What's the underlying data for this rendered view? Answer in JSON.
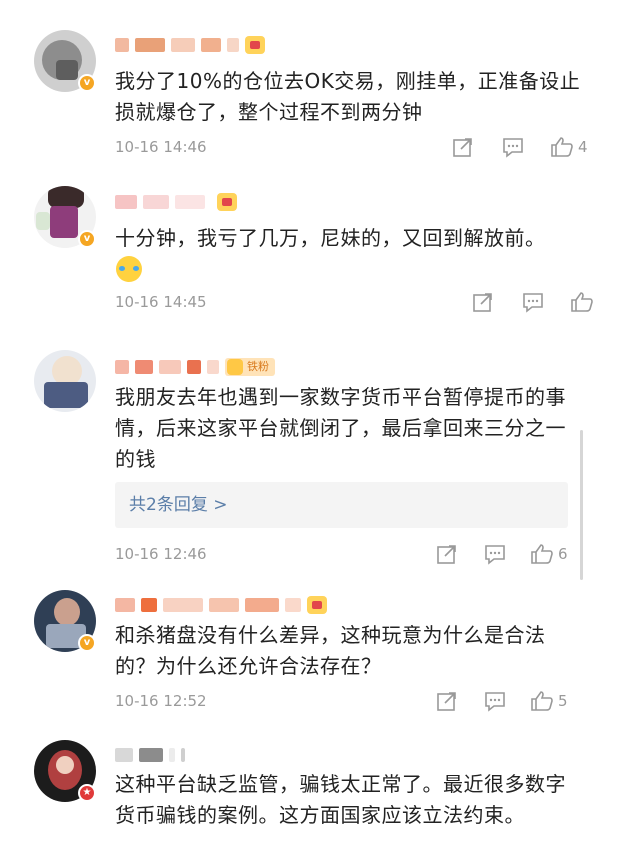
{
  "comments": [
    {
      "text": "我分了10%的仓位去OK交易，刚挂单，正准备设止损就爆仓了，整个过程不到两分钟",
      "time": "10-16 14:46",
      "likes": "4",
      "badge": "v"
    },
    {
      "text": "十分钟，我亏了几万，尼妹的，又回到解放前。",
      "time": "10-16 14:45",
      "likes": "",
      "badge": "v"
    },
    {
      "text": "我朋友去年也遇到一家数字货币平台暂停提币的事情，后来这家平台就倒闭了，最后拿回来三分之一的钱",
      "time": "10-16 12:46",
      "likes": "6",
      "replies": "共2条回复 >",
      "fan_badge": "铁粉"
    },
    {
      "text": "和杀猪盘没有什么差异，这种玩意为什么是合法的？为什么还允许合法存在？",
      "time": "10-16 12:52",
      "likes": "5",
      "badge": "v"
    },
    {
      "text": "这种平台缺乏监管，骗钱太正常了。最近很多数字货币骗钱的案例。这方面国家应该立法约束。",
      "time": "",
      "likes": "",
      "badge": "r"
    }
  ],
  "icons": {
    "share": "share-icon",
    "comment": "comment-icon",
    "like": "like-icon"
  },
  "colors": {
    "time": "#9a9a9a",
    "reply_link": "#5b7ea8",
    "verified": "#f5a623",
    "red_badge": "#e03a3a"
  }
}
